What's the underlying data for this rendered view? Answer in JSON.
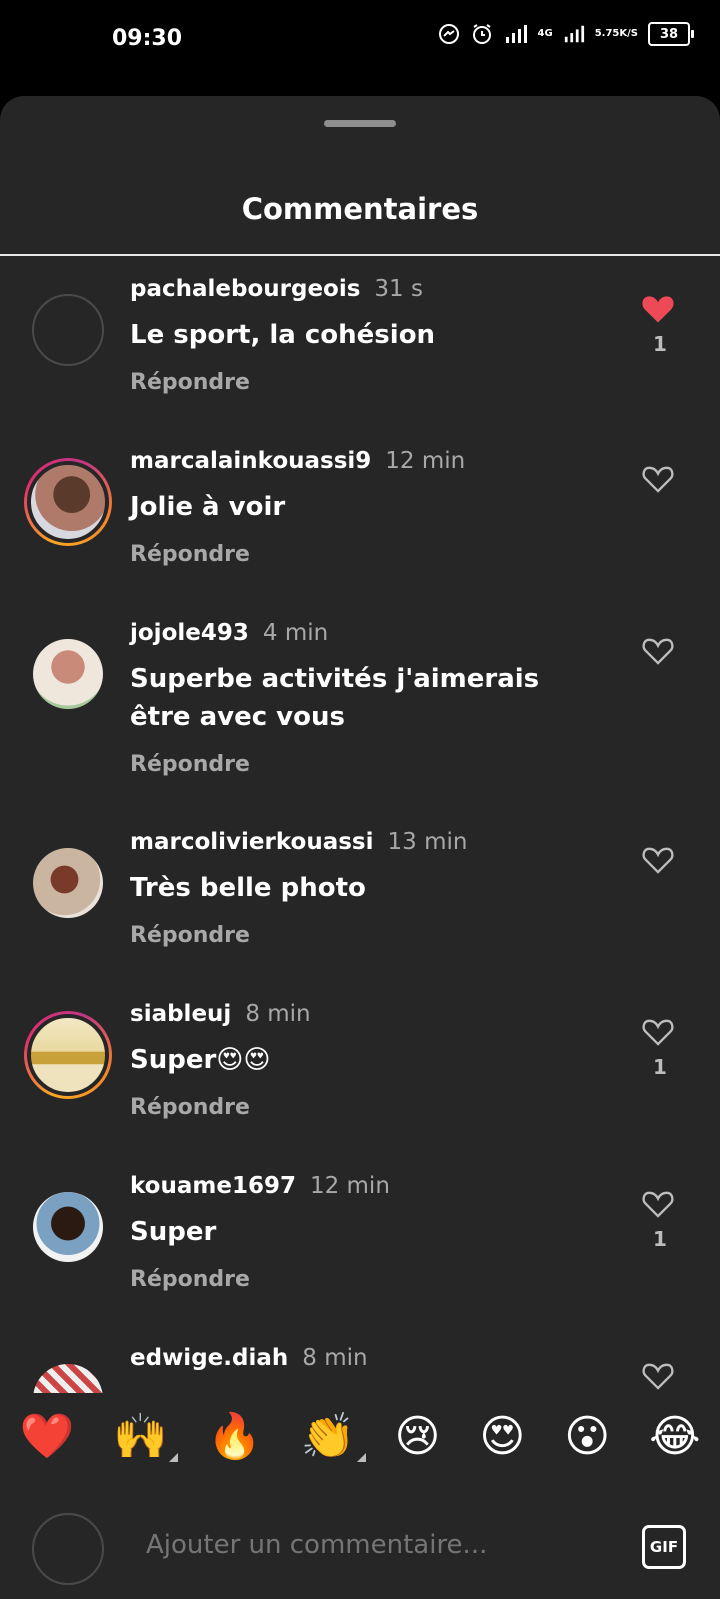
{
  "status": {
    "time": "09:30",
    "network": "4G",
    "speed_top": "5.75",
    "speed_bottom": "K/S",
    "battery": "38"
  },
  "sheet": {
    "title": "Commentaires"
  },
  "comments": [
    {
      "username": "pachalebourgeois",
      "time": "31 s",
      "text": "Le sport, la cohésion",
      "reply": "Répondre",
      "likes": "1",
      "liked": true
    },
    {
      "username": "marcalainkouassi9",
      "time": "12 min",
      "text": "Jolie à voir",
      "reply": "Répondre",
      "likes": "",
      "liked": false
    },
    {
      "username": "jojole493",
      "time": "4 min",
      "text": "Superbe activités j'aimerais être avec vous",
      "reply": "Répondre",
      "likes": "",
      "liked": false
    },
    {
      "username": "marcolivierkouassi",
      "time": "13 min",
      "text": "Très belle photo",
      "reply": "Répondre",
      "likes": "",
      "liked": false
    },
    {
      "username": "siableuj",
      "time": "8 min",
      "text": "Super😍😍",
      "reply": "Répondre",
      "likes": "1",
      "liked": false
    },
    {
      "username": "kouame1697",
      "time": "12 min",
      "text": "Super",
      "reply": "Répondre",
      "likes": "1",
      "liked": false
    },
    {
      "username": "edwige.diah",
      "time": "8 min",
      "text": "",
      "reply": "",
      "likes": "",
      "liked": false
    }
  ],
  "emoji_bar": [
    "❤️",
    "🙌",
    "🔥",
    "👏",
    "😢",
    "😍",
    "😮",
    "😂"
  ],
  "composer": {
    "placeholder": "Ajouter un commentaire...",
    "gif_label": "GIF"
  },
  "colors": {
    "like_red": "#ed4956",
    "sheet_bg": "#262626",
    "muted": "#a8a8a8"
  }
}
